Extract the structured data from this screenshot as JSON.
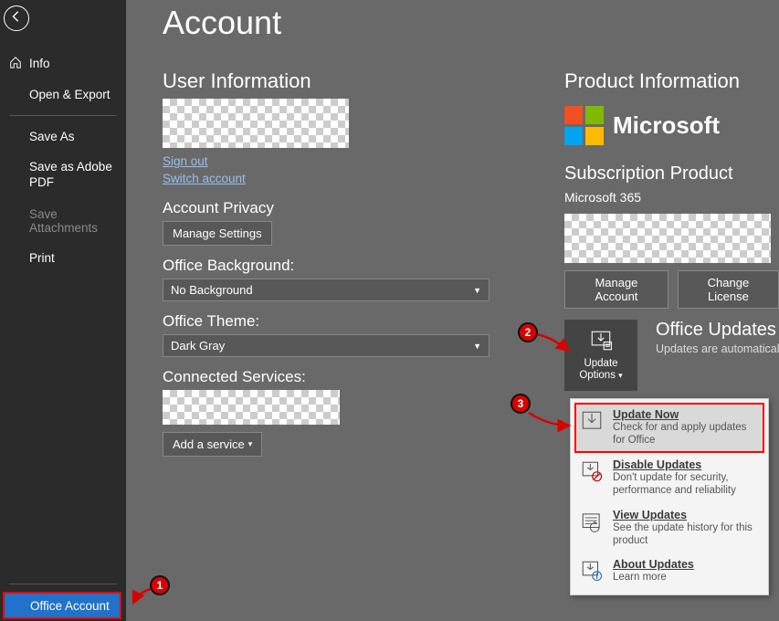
{
  "sidebar": {
    "items": [
      {
        "label": "Info",
        "icon": "home"
      },
      {
        "label": "Open & Export"
      },
      {
        "label": "Save As"
      },
      {
        "label": "Save as Adobe PDF"
      },
      {
        "label": "Save Attachments",
        "disabled": true
      },
      {
        "label": "Print"
      }
    ],
    "office_account": "Office Account"
  },
  "page": {
    "title": "Account"
  },
  "user_info": {
    "heading": "User Information",
    "sign_out": "Sign out",
    "switch_account": "Switch account"
  },
  "privacy": {
    "heading": "Account Privacy",
    "manage": "Manage Settings"
  },
  "background": {
    "heading": "Office Background:",
    "value": "No Background"
  },
  "theme": {
    "heading": "Office Theme:",
    "value": "Dark Gray"
  },
  "connected": {
    "heading": "Connected Services:",
    "add": "Add a service"
  },
  "product": {
    "heading": "Product Information",
    "brand": "Microsoft",
    "sub_heading": "Subscription Product",
    "sub_name": "Microsoft 365",
    "manage": "Manage Account",
    "change": "Change License"
  },
  "updates": {
    "button_line1": "Update",
    "button_line2": "Options",
    "heading": "Office Updates",
    "sub": "Updates are automatically"
  },
  "menu": {
    "items": [
      {
        "title": "Update Now",
        "desc": "Check for and apply updates for Office"
      },
      {
        "title": "Disable Updates",
        "desc": "Don't update for security, performance and reliability"
      },
      {
        "title": "View Updates",
        "desc": "See the update history for this product"
      },
      {
        "title": "About Updates",
        "desc": "Learn more"
      }
    ]
  },
  "badges": {
    "b1": "1",
    "b2": "2",
    "b3": "3"
  }
}
